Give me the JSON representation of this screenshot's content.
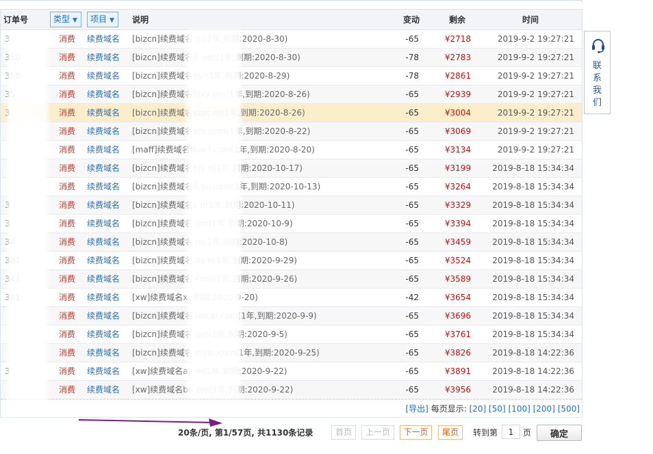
{
  "table": {
    "headers": {
      "order_no": "订单号",
      "type": "类型",
      "item": "项目",
      "desc": "说明",
      "change": "变动",
      "balance": "剩余",
      "time": "时间"
    },
    "rows": [
      {
        "order": "3",
        "type": "消费",
        "item": "续费域名",
        "desc": "[bizcn]续费域名                m(1年,到期:2020-8-30)",
        "change": "-65",
        "balance": "¥2718",
        "time": "2019-9-2 19:27:21"
      },
      {
        "order": "350",
        "type": "消费",
        "item": "续费域名",
        "desc": "[bizcn]续费域名ji              .net(1年,到期:2020-8-30)",
        "change": "-78",
        "balance": "¥2783",
        "time": "2019-9-2 19:27:21"
      },
      {
        "order": "350",
        "type": "消费",
        "item": "续费域名",
        "desc": "[bizcn]续费域名ny              (1年,到期:2020-8-29)",
        "change": "-78",
        "balance": "¥2861",
        "time": "2019-9-2 19:27:21"
      },
      {
        "order": "35",
        "type": "消费",
        "item": "续费域名",
        "desc": "[bizcn]续费域名bjxy         om(1年,到期:2020-8-26)",
        "change": "-65",
        "balance": "¥2939",
        "time": "2019-9-2 19:27:21"
      },
      {
        "order": "3",
        "type": "消费",
        "item": "续费域名",
        "desc": "[bizcn]续费域名szzc         m(1年,到期:2020-8-26)",
        "change": "-65",
        "balance": "¥3004",
        "time": "2019-9-2 19:27:21"
      },
      {
        "order": "",
        "type": "消费",
        "item": "续费域名",
        "desc": "[bizcn]续费域名am          com(1年,到期:2020-8-22)",
        "change": "-65",
        "balance": "¥3069",
        "time": "2019-9-2 19:27:21"
      },
      {
        "order": "",
        "type": "消费",
        "item": "续费域名",
        "desc": "[maff]续费域名due        f.com(1年,到期:2020-8-20)",
        "change": "-65",
        "balance": "¥3134",
        "time": "2019-9-2 19:27:21"
      },
      {
        "order": "",
        "type": "消费",
        "item": "续费域名",
        "desc": "[bizcn]续费域名bjy          n(1年,到期:2020-10-17)",
        "change": "-65",
        "balance": "¥3199",
        "time": "2019-8-18 15:34:34"
      },
      {
        "order": "",
        "type": "消费",
        "item": "续费域名",
        "desc": "[bizcn]续费域名0           ou.com(1年,到期:2020-10-13)",
        "change": "-65",
        "balance": "¥3264",
        "time": "2019-8-18 15:34:34"
      },
      {
        "order": "3",
        "type": "消费",
        "item": "续费域名",
        "desc": "[bizcn]续费域名c          n(1年,到期:2020-10-11)",
        "change": "-65",
        "balance": "¥3329",
        "time": "2019-8-18 15:34:34"
      },
      {
        "order": "3",
        "type": "消费",
        "item": "续费域名",
        "desc": "[bizcn]续费域名            om(1年,到期:2020-10-9)",
        "change": "-65",
        "balance": "¥3394",
        "time": "2019-8-18 15:34:34"
      },
      {
        "order": "34",
        "type": "消费",
        "item": "续费域名",
        "desc": "[bizcn]续费域名             m(1年,到期:2020-10-8)",
        "change": "-65",
        "balance": "¥3459",
        "time": "2019-8-18 15:34:34"
      },
      {
        "order": "341",
        "type": "消费",
        "item": "续费域名",
        "desc": "[bizcn]续费域名       ds      n(1年,到期:2020-9-29)",
        "change": "-65",
        "balance": "¥3524",
        "time": "2019-8-18 15:34:34"
      },
      {
        "order": "341",
        "type": "消费",
        "item": "续费域名",
        "desc": "[bizcn]续费域名            com(1年,到期:2020-9-26)",
        "change": "-65",
        "balance": "¥3589",
        "time": "2019-8-18 15:34:34"
      },
      {
        "order": "341",
        "type": "消费",
        "item": "续费域名",
        "desc": "[xw]续费域名x             ,到期:2020-9-20)",
        "change": "-42",
        "balance": "¥3654",
        "time": "2019-8-18 15:34:34"
      },
      {
        "order": "",
        "type": "消费",
        "item": "续费域名",
        "desc": "[bizcn]续费域名          uocai.com(1年,到期:2020-9-9)",
        "change": "-65",
        "balance": "¥3696",
        "time": "2019-8-18 15:34:34"
      },
      {
        "order": "",
        "type": "消费",
        "item": "续费域名",
        "desc": "[bizcn]续费域名            om(1年,到期:2020-9-5)",
        "change": "-65",
        "balance": "¥3761",
        "time": "2019-8-18 15:34:34"
      },
      {
        "order": "",
        "type": "消费",
        "item": "续费域名",
        "desc": "[bizcn]续费域名          eiyin.com(1年,到期:2020-9-25)",
        "change": "-65",
        "balance": "¥3826",
        "time": "2019-8-18 14:22:36"
      },
      {
        "order": "3",
        "type": "消费",
        "item": "续费域名",
        "desc": "[xw]续费域名az          m(1年,到期:2020-9-22)",
        "change": "-65",
        "balance": "¥3891",
        "time": "2019-8-18 14:22:36"
      },
      {
        "order": "",
        "type": "消费",
        "item": "续费域名",
        "desc": "[xw]续费域名bn           om(1年,到期:2020-9-22)",
        "change": "-65",
        "balance": "¥3956",
        "time": "2019-8-18 14:22:36"
      }
    ]
  },
  "footer": {
    "export_label": "[导出]",
    "per_page_label": "每页显示:",
    "page_sizes": [
      "[20]",
      "[50]",
      "[100]",
      "[200]",
      "[500]"
    ]
  },
  "pager": {
    "summary": "20条/页, 第1/57页, 共1130条记录",
    "first": "首页",
    "prev": "上一页",
    "next": "下一页",
    "last": "尾页",
    "goto_label": "转到第",
    "goto_value": "1",
    "goto_unit": "页",
    "confirm": "确定"
  },
  "contact": {
    "chars": [
      "联",
      "系",
      "我",
      "们"
    ],
    "icon": "headset-icon"
  },
  "colors": {
    "type_text": "#c0392b",
    "link": "#2a6fb8",
    "balance": "#c0120f",
    "highlight_row": "#fdeecb",
    "pager_active": "#e05a00",
    "annotation_arrow": "#7a1a8a"
  }
}
